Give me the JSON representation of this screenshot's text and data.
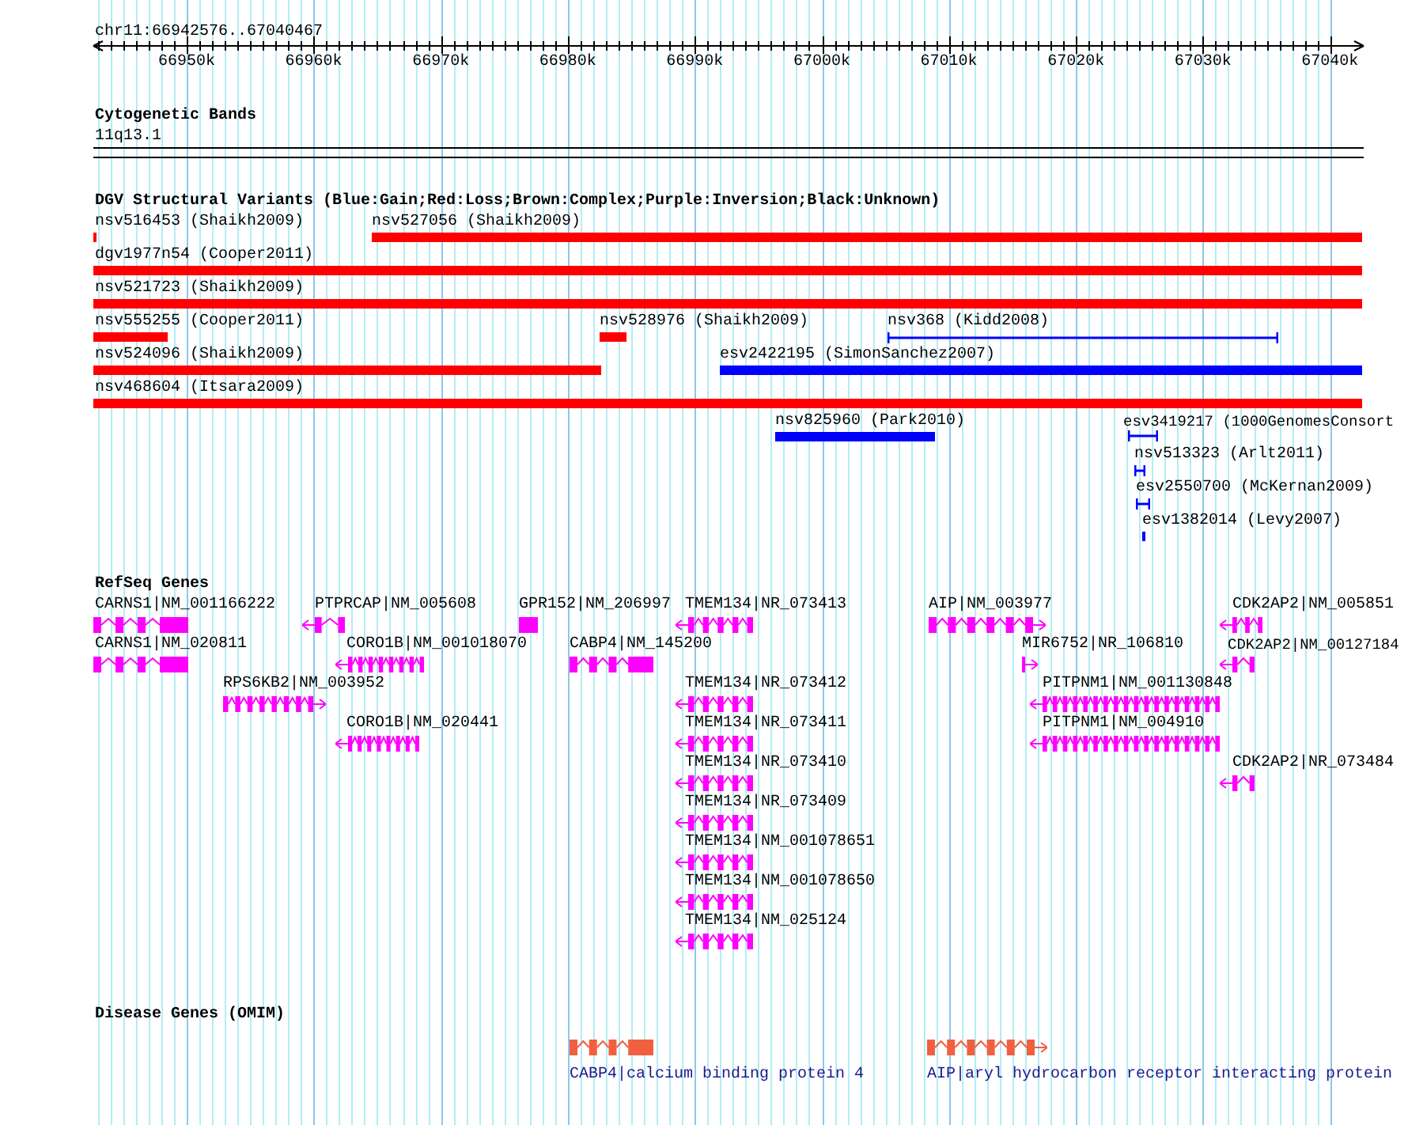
{
  "ruler": {
    "region": "chr11:66942576..67040467",
    "ticks": [
      "66950k",
      "66960k",
      "66970k",
      "66980k",
      "66990k",
      "67000k",
      "67010k",
      "67020k",
      "67030k",
      "67040k"
    ]
  },
  "cytobands": {
    "title": "Cytogenetic Bands",
    "band": "11q13.1"
  },
  "dgv": {
    "title": "DGV Structural Variants (Blue:Gain;Red:Loss;Brown:Complex;Purple:Inversion;Black:Unknown)",
    "features": [
      {
        "label": "nsv516453 (Shaikh2009)",
        "color": "#ff0000",
        "kind": "bar"
      },
      {
        "label": "nsv527056 (Shaikh2009)",
        "color": "#ff0000",
        "kind": "bar"
      },
      {
        "label": "dgv1977n54 (Cooper2011)",
        "color": "#ff0000",
        "kind": "bar"
      },
      {
        "label": "nsv521723 (Shaikh2009)",
        "color": "#ff0000",
        "kind": "bar"
      },
      {
        "label": "nsv555255 (Cooper2011)",
        "color": "#ff0000",
        "kind": "bar"
      },
      {
        "label": "nsv528976 (Shaikh2009)",
        "color": "#ff0000",
        "kind": "bar"
      },
      {
        "label": "nsv368 (Kidd2008)",
        "color": "#0000ff",
        "kind": "span"
      },
      {
        "label": "nsv524096 (Shaikh2009)",
        "color": "#ff0000",
        "kind": "bar"
      },
      {
        "label": "esv2422195 (SimonSanchez2007)",
        "color": "#0000ff",
        "kind": "bar"
      },
      {
        "label": "nsv468604 (Itsara2009)",
        "color": "#ff0000",
        "kind": "bar"
      },
      {
        "label": "nsv825960 (Park2010)",
        "color": "#0000ff",
        "kind": "bar"
      },
      {
        "label": "esv3419217 (1000GenomesConsort",
        "color": "#0000ff",
        "kind": "span"
      },
      {
        "label": "nsv513323 (Arlt2011)",
        "color": "#0000ff",
        "kind": "span"
      },
      {
        "label": "esv2550700 (McKernan2009)",
        "color": "#0000ff",
        "kind": "span"
      },
      {
        "label": "esv1382014 (Levy2007)",
        "color": "#0000ff",
        "kind": "bar"
      }
    ]
  },
  "refseq": {
    "title": "RefSeq Genes",
    "genes": [
      {
        "label": "CARNS1|NM_001166222",
        "kind": "plain"
      },
      {
        "label": "PTPRCAP|NM_005608",
        "kind": "reverse"
      },
      {
        "label": "GPR152|NM_206997",
        "kind": "plain"
      },
      {
        "label": "TMEM134|NR_073413",
        "kind": "reverse"
      },
      {
        "label": "AIP|NM_003977",
        "kind": "forward"
      },
      {
        "label": "CDK2AP2|NM_005851",
        "kind": "reverse"
      },
      {
        "label": "CARNS1|NM_020811",
        "kind": "plain"
      },
      {
        "label": "CORO1B|NM_001018070",
        "kind": "reverse"
      },
      {
        "label": "CABP4|NM_145200",
        "kind": "plain"
      },
      {
        "label": "MIR6752|NR_106810",
        "kind": "forward"
      },
      {
        "label": "CDK2AP2|NM_00127184",
        "kind": "reverse"
      },
      {
        "label": "RPS6KB2|NM_003952",
        "kind": "forward"
      },
      {
        "label": "TMEM134|NR_073412",
        "kind": "reverse"
      },
      {
        "label": "PITPNM1|NM_001130848",
        "kind": "reverse"
      },
      {
        "label": "CORO1B|NM_020441",
        "kind": "reverse"
      },
      {
        "label": "TMEM134|NR_073411",
        "kind": "reverse"
      },
      {
        "label": "PITPNM1|NM_004910",
        "kind": "reverse"
      },
      {
        "label": "TMEM134|NR_073410",
        "kind": "reverse"
      },
      {
        "label": "CDK2AP2|NR_073484",
        "kind": "reverse"
      },
      {
        "label": "TMEM134|NR_073409",
        "kind": "reverse"
      },
      {
        "label": "TMEM134|NM_001078651",
        "kind": "reverse"
      },
      {
        "label": "TMEM134|NM_001078650",
        "kind": "reverse"
      },
      {
        "label": "TMEM134|NM_025124",
        "kind": "reverse"
      }
    ]
  },
  "omim": {
    "title": "Disease Genes (OMIM)",
    "genes": [
      {
        "label": "CABP4|calcium binding protein 4",
        "kind": "plain"
      },
      {
        "label": "AIP|aryl hydrocarbon receptor interacting protein",
        "kind": "forward"
      }
    ]
  }
}
